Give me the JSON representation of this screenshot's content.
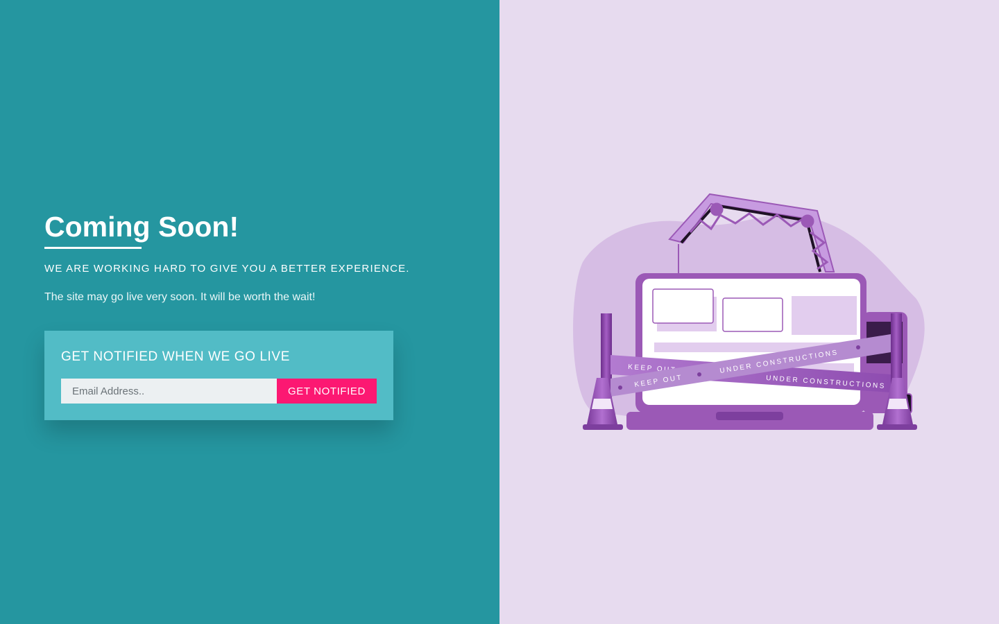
{
  "hero": {
    "title": "Coming Soon!",
    "subtitle": "WE ARE WORKING HARD TO GIVE YOU A BETTER EXPERIENCE.",
    "description": "The site may go live very soon. It will be worth the wait!"
  },
  "notify": {
    "heading": "GET NOTIFIED WHEN WE GO LIVE",
    "email_placeholder": "Email Address..",
    "email_value": "",
    "button_label": "GET NOTIFIED"
  },
  "illustration": {
    "tape_text_1": "KEEP OUT",
    "tape_text_2": "UNDER CONSTRUCTIONS",
    "tape_text_3": "KEEP OUT",
    "tape_text_4": "UNDER CONSTRUCTIONS"
  },
  "colors": {
    "left_background": "#2596a0",
    "right_background": "#e7dbef",
    "card_background": "#52bcc6",
    "button_background": "#fc1872",
    "illustration_purple": "#9b59b6"
  }
}
